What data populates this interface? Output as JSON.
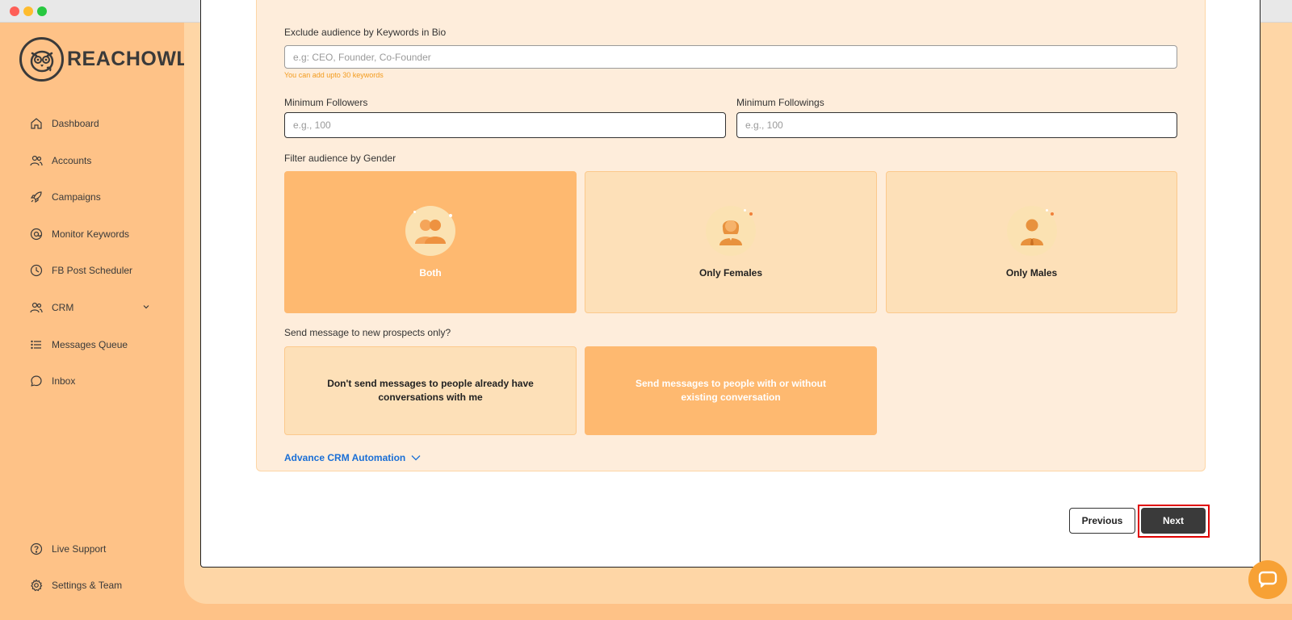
{
  "brand": {
    "name": "REACHOWL"
  },
  "sidebar": {
    "items": [
      {
        "label": "Dashboard",
        "icon": "home-icon"
      },
      {
        "label": "Accounts",
        "icon": "users-icon"
      },
      {
        "label": "Campaigns",
        "icon": "rocket-icon"
      },
      {
        "label": "Monitor Keywords",
        "icon": "at-icon"
      },
      {
        "label": "FB Post Scheduler",
        "icon": "clock-icon"
      },
      {
        "label": "CRM",
        "icon": "users-icon"
      },
      {
        "label": "Messages Queue",
        "icon": "list-icon"
      },
      {
        "label": "Inbox",
        "icon": "chat-icon"
      }
    ],
    "bottom_items": [
      {
        "label": "Live Support",
        "icon": "help-icon"
      },
      {
        "label": "Settings & Team",
        "icon": "gear-icon"
      }
    ]
  },
  "form": {
    "exclude_keywords": {
      "label": "Exclude audience by Keywords in Bio",
      "placeholder": "e.g: CEO, Founder, Co-Founder",
      "hint": "You can add upto 30 keywords"
    },
    "min_followers": {
      "label": "Minimum Followers",
      "placeholder": "e.g., 100"
    },
    "min_followings": {
      "label": "Minimum Followings",
      "placeholder": "e.g., 100"
    },
    "gender": {
      "label": "Filter audience by Gender",
      "options": [
        {
          "label": "Both",
          "selected": true
        },
        {
          "label": "Only Females",
          "selected": false
        },
        {
          "label": "Only Males",
          "selected": false
        }
      ]
    },
    "new_prospects": {
      "label": "Send message to new prospects only?",
      "options": [
        {
          "label": "Don't send messages to people already have conversations with me",
          "selected": false
        },
        {
          "label": "Send messages to people with or without existing conversation",
          "selected": true
        }
      ]
    },
    "advance_link": "Advance CRM Automation"
  },
  "actions": {
    "previous": "Previous",
    "next": "Next"
  },
  "colors": {
    "sidebar_bg": "#fec287",
    "panel_bg": "#feeddb",
    "card_bg": "#fde0b8",
    "card_selected_bg": "#feb970",
    "link": "#1a6fd6",
    "hint": "#f39b1d",
    "primary_button": "#3a3a3a",
    "highlight": "#e00000"
  }
}
